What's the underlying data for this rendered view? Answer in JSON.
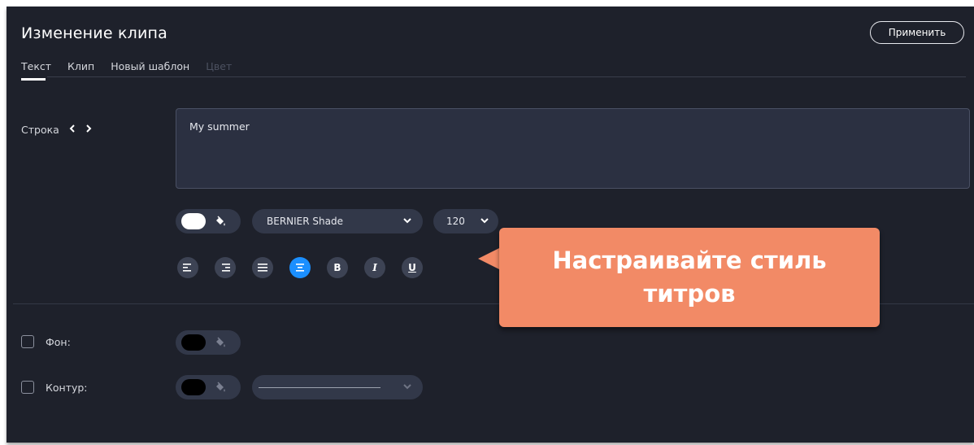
{
  "header": {
    "title": "Изменение клипа",
    "apply_label": "Применить"
  },
  "tabs": [
    {
      "label": "Текст",
      "active": true
    },
    {
      "label": "Клип",
      "active": false
    },
    {
      "label": "Новый шаблон",
      "active": false
    },
    {
      "label": "Цвет",
      "active": false,
      "disabled": true
    }
  ],
  "line_editor": {
    "label": "Строка",
    "prev_icon": "chevron-left-icon",
    "next_icon": "chevron-right-icon",
    "value": "My summer"
  },
  "text_style": {
    "text_color": "#ffffff",
    "font": "BERNIER Shade",
    "size": "120",
    "buttons": [
      {
        "name": "align-left-icon",
        "selected": false
      },
      {
        "name": "align-right-icon",
        "selected": false
      },
      {
        "name": "align-justify-icon",
        "selected": false
      },
      {
        "name": "align-center-icon",
        "selected": true
      },
      {
        "name": "bold-icon",
        "glyph": "B",
        "selected": false
      },
      {
        "name": "italic-icon",
        "glyph": "I",
        "selected": false
      },
      {
        "name": "underline-icon",
        "glyph": "U",
        "selected": false
      }
    ]
  },
  "background": {
    "label": "Фон:",
    "checked": false,
    "color": "#000000"
  },
  "outline": {
    "label": "Контур:",
    "checked": false,
    "color": "#000000",
    "style_icon": "line-style-icon"
  },
  "callout": {
    "line1": "Настраивайте стиль",
    "line2": "титров",
    "color": "#f28a66"
  },
  "colors": {
    "panel": "#1e212b",
    "accent": "#1b8fff"
  }
}
